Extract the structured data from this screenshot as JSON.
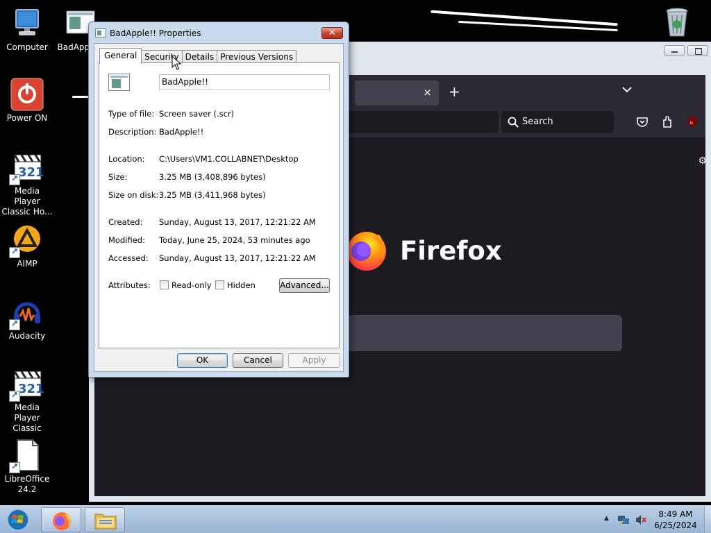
{
  "desktop": {
    "icons": [
      {
        "label": "Computer"
      },
      {
        "label": "BadApple!!"
      },
      {
        "label": "Power ON"
      },
      {
        "label": "Media Player Classic Ho..."
      },
      {
        "label": "AIMP"
      },
      {
        "label": "Audacity"
      },
      {
        "label": "Media Player Classic"
      },
      {
        "label": "LibreOffice 24.2"
      },
      {
        "label": "Recycle Bin"
      }
    ]
  },
  "firefox": {
    "search_label": "Search",
    "wordmark": "Firefox",
    "tab_close": "×",
    "new_tab": "+",
    "list_tabs": "⌄"
  },
  "dialog": {
    "title": "BadApple!! Properties",
    "close_label": "✕",
    "tabs": [
      {
        "label": "General",
        "active": true
      },
      {
        "label": "Security"
      },
      {
        "label": "Details"
      },
      {
        "label": "Previous Versions"
      }
    ],
    "file_name": "BadApple!!",
    "properties": {
      "type": {
        "label": "Type of file:",
        "value": "Screen saver (.scr)"
      },
      "description": {
        "label": "Description:",
        "value": "BadApple!!"
      },
      "location": {
        "label": "Location:",
        "value": "C:\\Users\\VM1.COLLABNET\\Desktop"
      },
      "size": {
        "label": "Size:",
        "value": "3.25 MB (3,408,896 bytes)"
      },
      "size_on_disk": {
        "label": "Size on disk:",
        "value": "3.25 MB (3,411,968 bytes)"
      },
      "created": {
        "label": "Created:",
        "value": "Sunday, August 13, 2017, 12:21:22 AM"
      },
      "modified": {
        "label": "Modified:",
        "value": "Today, June 25, 2024, 53 minutes ago"
      },
      "accessed": {
        "label": "Accessed:",
        "value": "Sunday, August 13, 2017, 12:21:22 AM"
      }
    },
    "attributes": {
      "label": "Attributes:",
      "readonly": {
        "label": "Read-only",
        "checked": false
      },
      "hidden": {
        "label": "Hidden",
        "checked": false
      },
      "advanced_label": "Advanced..."
    },
    "buttons": {
      "ok": "OK",
      "cancel": "Cancel",
      "apply": "Apply"
    }
  },
  "taskbar": {
    "clock_time": "8:49 AM",
    "clock_date": "6/25/2024",
    "tray_arrow": "▲"
  }
}
